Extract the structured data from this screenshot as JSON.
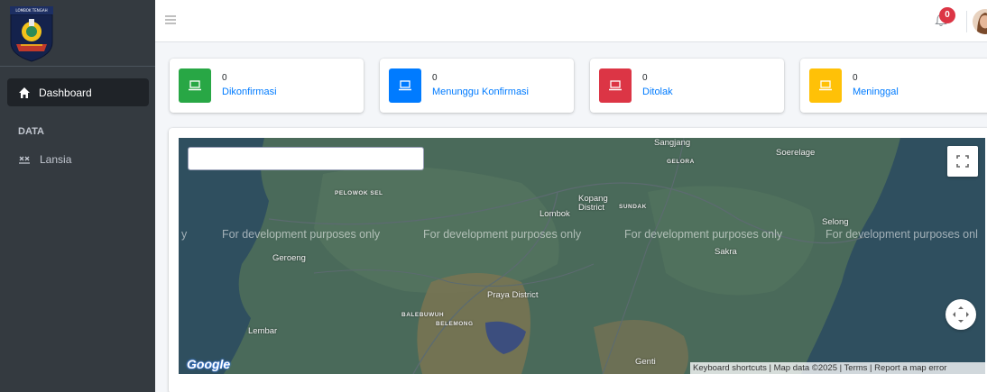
{
  "sidebar": {
    "logo_text": "LOMBOK TENGAH",
    "nav": {
      "dashboard_label": "Dashboard",
      "section_header": "DATA",
      "lansia_label": "Lansia"
    }
  },
  "header": {
    "menu_icon": "hamburger-icon",
    "notification_icon": "bell-icon",
    "notification_count": "0",
    "avatar_icon": "user-avatar"
  },
  "stats": [
    {
      "count": "0",
      "label": "Dikonfirmasi",
      "color": "#28a745",
      "icon": "laptop-icon"
    },
    {
      "count": "0",
      "label": "Menunggu Konfirmasi",
      "color": "#007bff",
      "icon": "laptop-icon"
    },
    {
      "count": "0",
      "label": "Ditolak",
      "color": "#dc3545",
      "icon": "laptop-icon"
    },
    {
      "count": "0",
      "label": "Meninggal",
      "color": "#ffc107",
      "icon": "laptop-icon"
    }
  ],
  "map": {
    "search_value": "",
    "dev_watermark_parts": [
      "y",
      "For development purposes only",
      "For development purposes only",
      "For development purposes only",
      "For development purposes onl"
    ],
    "places": {
      "sangjang": "Sangjang",
      "gelora": "GELORA",
      "soerelage": "Soerelage",
      "pelowok_sel": "PELOWOK SEL",
      "kopang_1": "Kopang",
      "kopang_2": "District",
      "sundak": "SUNDAK",
      "lombok": "Lombok",
      "selong": "Selong",
      "sakra": "Sakra",
      "geroeng": "Geroeng",
      "praya": "Praya District",
      "balebuwuh": "BALEBUWUH",
      "belemong": "BELEMONG",
      "lembar": "Lembar",
      "genti": "Genti"
    },
    "google_logo": "Google",
    "attribution": "Keyboard shortcuts | Map data ©2025 | Terms | Report a map error"
  }
}
